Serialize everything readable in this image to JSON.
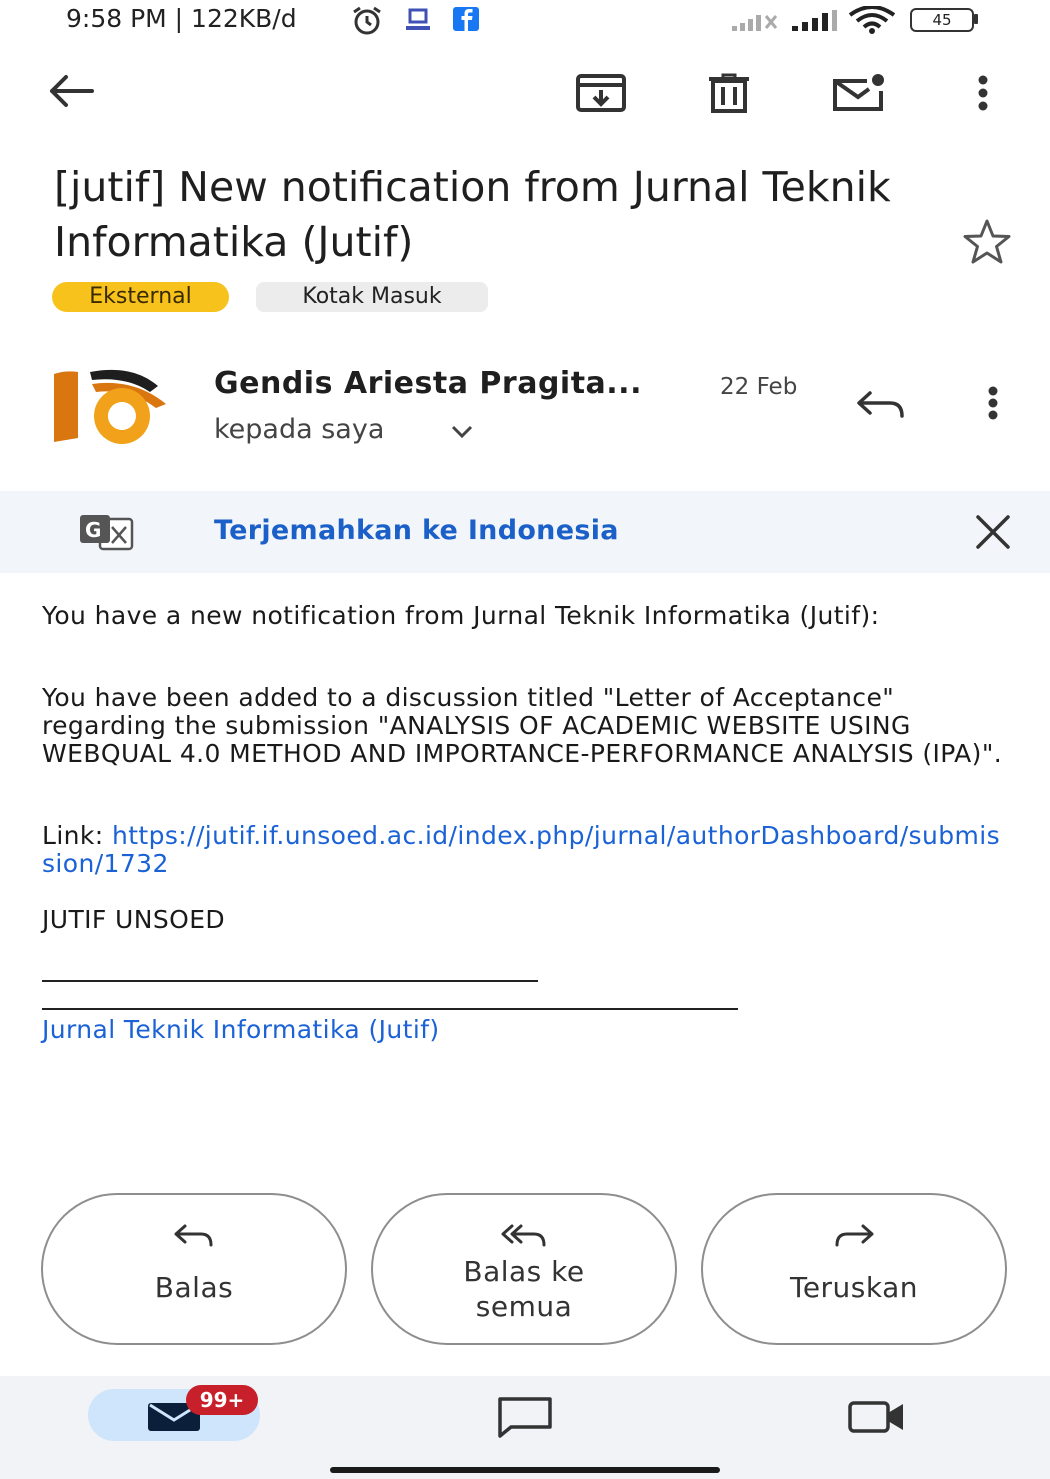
{
  "status_bar": {
    "time_text": "9:58 PM | 122KB/d",
    "battery": "45"
  },
  "app_bar": {
    "icons": [
      "back-arrow-icon",
      "archive-icon",
      "delete-icon",
      "mark-unread-icon",
      "more-vert-icon"
    ]
  },
  "email": {
    "subject": "[jutif] New notification from Jurnal Teknik Informatika (Jutif)",
    "labels": [
      "Eksternal",
      "Kotak Masuk"
    ],
    "sender_name": "Gendis Ariesta Pragita...",
    "date": "22 Feb",
    "recipient": "kepada saya"
  },
  "translate_bar": {
    "label": "Terjemahkan ke Indonesia"
  },
  "body": {
    "p1": "You have a new notification from Jurnal Teknik Informatika (Jutif):",
    "p2": "You have been added to a discussion titled \"Letter of Acceptance\" regarding the submission \"ANALYSIS OF ACADEMIC WEBSITE USING WEBQUAL 4.0 METHOD AND IMPORTANCE-PERFORMANCE ANALYSIS (IPA)\".",
    "link_prefix": "Link: ",
    "link_url": "https://jutif.if.unsoed.ac.id/index.php/jurnal/authorDashboard/submission/1732",
    "signature": "JUTIF UNSOED",
    "footer_link": "Jurnal Teknik Informatika (Jutif)"
  },
  "actions": {
    "reply": "Balas",
    "reply_all_line1": "Balas ke",
    "reply_all_line2": "semua",
    "forward": "Teruskan"
  },
  "bottom_nav": {
    "mail_badge": "99+"
  },
  "colors": {
    "accent_blue": "#1a62d6",
    "external_chip": "#f8c21c",
    "badge_red": "#c8202a"
  }
}
